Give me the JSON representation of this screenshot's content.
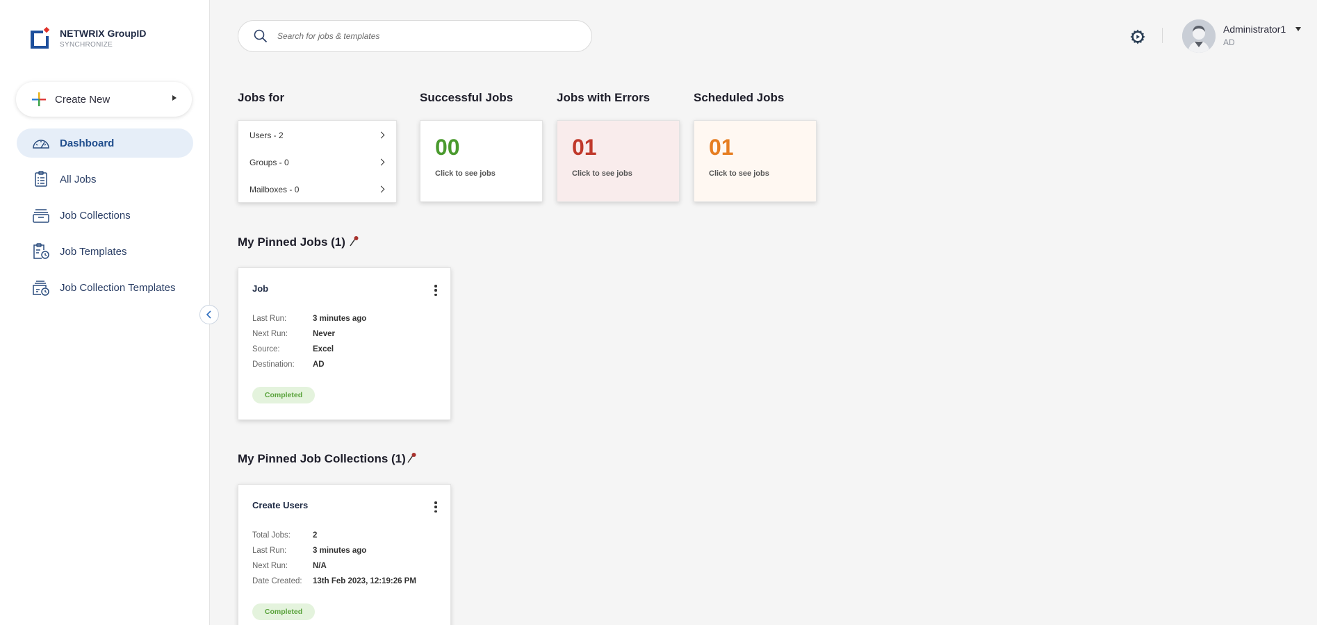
{
  "brand": {
    "name": "NETWRIX GroupID",
    "sub": "SYNCHRONIZE"
  },
  "sidebar": {
    "create_new": "Create New",
    "items": [
      {
        "label": "Dashboard",
        "icon": "speedometer-icon",
        "active": true
      },
      {
        "label": "All Jobs",
        "icon": "clipboard-list-icon"
      },
      {
        "label": "Job Collections",
        "icon": "folder-stack-icon"
      },
      {
        "label": "Job Templates",
        "icon": "clipboard-clock-icon"
      },
      {
        "label": "Job Collection Templates",
        "icon": "printer-clock-icon"
      }
    ]
  },
  "header": {
    "search_placeholder": "Search for jobs & templates",
    "user_name": "Administrator1",
    "user_domain": "AD"
  },
  "summary": {
    "jobs_for": {
      "title": "Jobs for",
      "rows": [
        "Users - 2",
        "Groups - 0",
        "Mailboxes - 0"
      ]
    },
    "successful": {
      "title": "Successful Jobs",
      "value": "00",
      "hint": "Click to see jobs",
      "color": "#4a9a2e"
    },
    "errors": {
      "title": "Jobs with Errors",
      "value": "01",
      "hint": "Click to see jobs",
      "color": "#c0392b"
    },
    "scheduled": {
      "title": "Scheduled Jobs",
      "value": "01",
      "hint": "Click to see jobs",
      "color": "#e67e22"
    }
  },
  "pinned_jobs": {
    "heading": "My Pinned Jobs (1)",
    "card": {
      "title": "Job",
      "fields": [
        {
          "k": "Last Run:",
          "v": "3 minutes ago"
        },
        {
          "k": "Next Run:",
          "v": "Never"
        },
        {
          "k": "Source:",
          "v": "Excel"
        },
        {
          "k": "Destination:",
          "v": "AD"
        }
      ],
      "status": "Completed"
    }
  },
  "pinned_collections": {
    "heading": "My Pinned Job Collections (1)",
    "card": {
      "title": "Create Users",
      "fields": [
        {
          "k": "Total Jobs:",
          "v": "2"
        },
        {
          "k": "Last Run:",
          "v": "3 minutes ago"
        },
        {
          "k": "Next Run:",
          "v": "N/A"
        },
        {
          "k": "Date Created:",
          "v": "13th Feb 2023, 12:19:26 PM"
        }
      ],
      "status": "Completed"
    }
  }
}
